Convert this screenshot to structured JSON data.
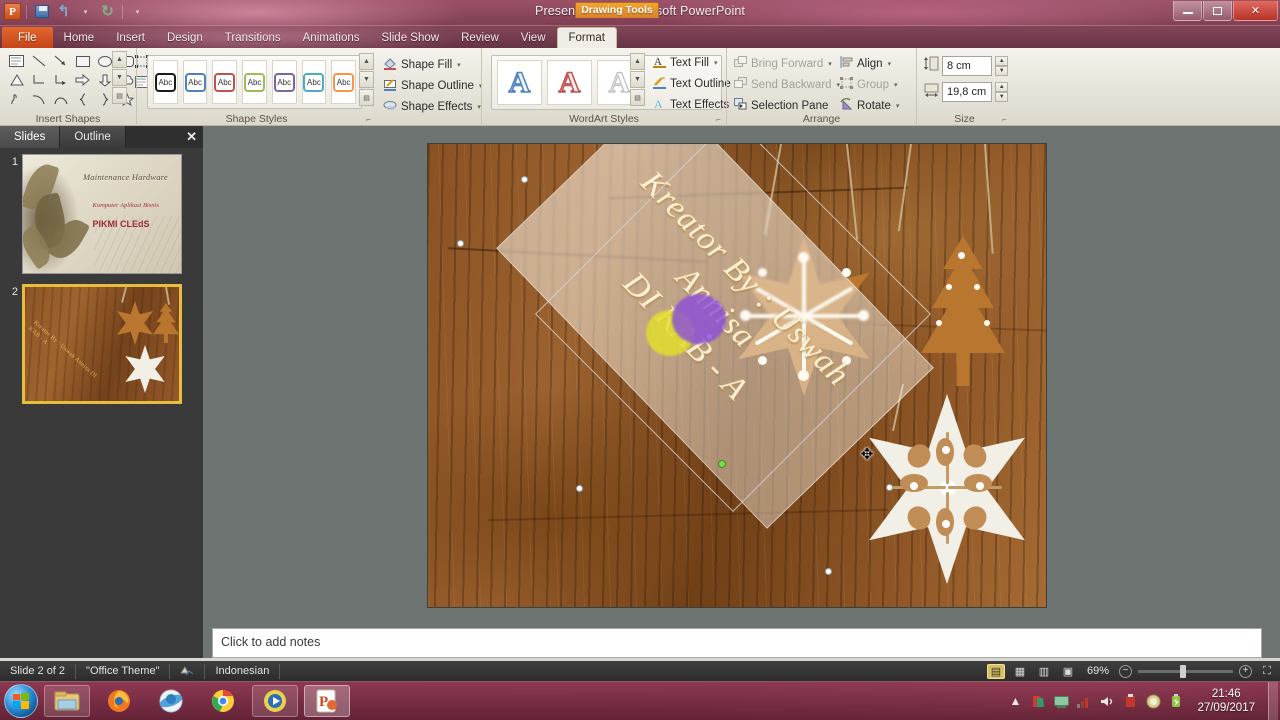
{
  "window": {
    "title": "Presentation1  -  Microsoft PowerPoint",
    "contextual_tab_label": "Drawing Tools",
    "minimize": "–",
    "maximize": "□",
    "close": "✕"
  },
  "quick_access": {
    "app_icon": "P",
    "save": "save-icon",
    "undo": "↰",
    "undo_dropdown": "▾",
    "redo": "↻",
    "customize": "▾"
  },
  "tabs": [
    {
      "label": "File",
      "active": false
    },
    {
      "label": "Home",
      "active": false
    },
    {
      "label": "Insert",
      "active": false
    },
    {
      "label": "Design",
      "active": false
    },
    {
      "label": "Transitions",
      "active": false
    },
    {
      "label": "Animations",
      "active": false
    },
    {
      "label": "Slide Show",
      "active": false
    },
    {
      "label": "Review",
      "active": false
    },
    {
      "label": "View",
      "active": false
    },
    {
      "label": "Format",
      "active": true
    }
  ],
  "ribbon": {
    "insert_shapes": {
      "label": "Insert Shapes",
      "edit_shape": "Edit Shape",
      "text_box": "Text Box",
      "dropdown_arrow": "▾",
      "scroll_up": "▲",
      "scroll_down": "▼",
      "scroll_more": "▤"
    },
    "shape_styles": {
      "label": "Shape Styles",
      "sample_text": "Abc",
      "swatch_colors": [
        "#1a1a1a",
        "#4f81bd",
        "#c0504d",
        "#9bbb59",
        "#8064a2",
        "#4bacc6",
        "#f79646"
      ],
      "dialog_launcher": "⌐"
    },
    "shape_format": {
      "fill": "Shape Fill",
      "outline": "Shape Outline",
      "effects": "Shape Effects",
      "arrow": "▾"
    },
    "wordart": {
      "label": "WordArt Styles",
      "glyph": "A",
      "sample_colors": [
        "#4f81bd",
        "#c0504d",
        "#bfbfbf"
      ],
      "text_fill": "Text Fill",
      "text_outline": "Text Outline",
      "text_effects": "Text Effects",
      "arrow": "▾",
      "dialog_launcher": "⌐"
    },
    "arrange": {
      "label": "Arrange",
      "bring_forward": "Bring Forward",
      "send_backward": "Send Backward",
      "selection_pane": "Selection Pane",
      "align": "Align",
      "group": "Group",
      "rotate": "Rotate",
      "arrow": "▾"
    },
    "size": {
      "label": "Size",
      "height_value": "8 cm",
      "width_value": "19,8 cm",
      "spin_up": "▲",
      "spin_down": "▼",
      "dialog_launcher": "⌐"
    }
  },
  "slides_pane": {
    "tab_slides": "Slides",
    "tab_outline": "Outline",
    "close": "✕",
    "thumbnails": [
      {
        "number": "1",
        "selected": false,
        "title": "Maintenance Hardware",
        "subtitle": "Komputer Aplikasi Bisnis",
        "caption": "PIKMI CLEdS"
      },
      {
        "number": "2",
        "selected": true,
        "text": "Kreator By : Uswah Annisa DI KAB - A"
      }
    ]
  },
  "slide_canvas": {
    "shape_text": "Kreator By : Uswah Annisa\nDI KAB - A",
    "selected": true,
    "rotation_handle": "rotation-handle"
  },
  "notes": {
    "placeholder": "Click to add notes"
  },
  "status_bar": {
    "slide_indicator": "Slide 2 of 2",
    "theme": "\"Office Theme\"",
    "spell_icon": "spell-check-icon",
    "language": "Indonesian",
    "views": [
      {
        "name": "normal-view",
        "glyph": "▤",
        "selected": true
      },
      {
        "name": "slide-sorter-view",
        "glyph": "▦",
        "selected": false
      },
      {
        "name": "reading-view",
        "glyph": "▥",
        "selected": false
      },
      {
        "name": "slide-show-view",
        "glyph": "▣",
        "selected": false
      }
    ],
    "zoom_level": "69%",
    "zoom_out": "−",
    "zoom_in": "+",
    "fit_to_window": "⛶"
  },
  "taskbar": {
    "start": "start-orb",
    "items": [
      {
        "name": "windows-explorer",
        "glyph": "🗂"
      },
      {
        "name": "firefox",
        "glyph": "◉"
      },
      {
        "name": "internet-explorer",
        "glyph": "◍"
      },
      {
        "name": "google-chrome",
        "glyph": "◉"
      },
      {
        "name": "media-player",
        "glyph": "▶"
      },
      {
        "name": "powerpoint",
        "glyph": "P"
      }
    ],
    "tray": [
      {
        "name": "show-hidden-icons",
        "glyph": "▲"
      },
      {
        "name": "antivirus-icon",
        "glyph": "◤"
      },
      {
        "name": "network-icon",
        "glyph": "🖥"
      },
      {
        "name": "signal-icon",
        "glyph": "▂▄▆"
      },
      {
        "name": "volume-icon",
        "glyph": "🔊"
      },
      {
        "name": "usb-icon",
        "glyph": "⬒"
      },
      {
        "name": "shield-icon",
        "glyph": "◐"
      },
      {
        "name": "battery-icon",
        "glyph": "▮"
      }
    ],
    "clock_time": "21:46",
    "clock_date": "27/09/2017"
  },
  "colors": {
    "accent_orange": "#d9822b",
    "file_tab": "#c8431a",
    "selected_thumb": "#e8bc3c",
    "wordart_text": "#fff7e0"
  }
}
